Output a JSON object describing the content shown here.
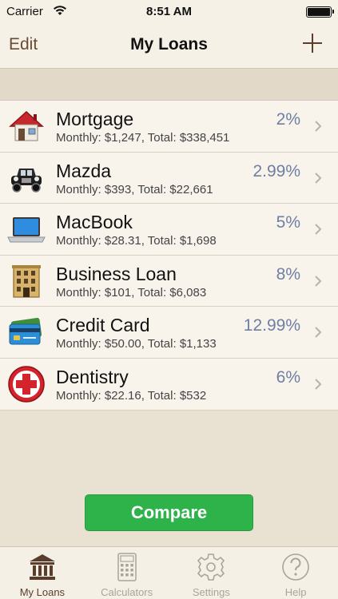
{
  "status_bar": {
    "carrier": "Carrier",
    "time": "8:51 AM"
  },
  "nav": {
    "edit_label": "Edit",
    "title": "My Loans"
  },
  "loans": [
    {
      "name": "Mortgage",
      "summary": "Monthly: $1,247, Total: $338,451",
      "rate": "2%",
      "icon": "house-icon"
    },
    {
      "name": "Mazda",
      "summary": "Monthly: $393, Total: $22,661",
      "rate": "2.99%",
      "icon": "car-icon"
    },
    {
      "name": "MacBook",
      "summary": "Monthly: $28.31, Total: $1,698",
      "rate": "5%",
      "icon": "laptop-icon"
    },
    {
      "name": "Business Loan",
      "summary": "Monthly: $101, Total: $6,083",
      "rate": "8%",
      "icon": "building-icon"
    },
    {
      "name": "Credit Card",
      "summary": "Monthly: $50.00, Total: $1,133",
      "rate": "12.99%",
      "icon": "credit-card-icon"
    },
    {
      "name": "Dentistry",
      "summary": "Monthly: $22.16, Total: $532",
      "rate": "6%",
      "icon": "red-cross-icon"
    }
  ],
  "compare_label": "Compare",
  "tabs": [
    {
      "label": "My Loans",
      "icon": "bank-icon",
      "active": true
    },
    {
      "label": "Calculators",
      "icon": "calculator-icon",
      "active": false
    },
    {
      "label": "Settings",
      "icon": "gear-icon",
      "active": false
    },
    {
      "label": "Help",
      "icon": "help-icon",
      "active": false
    }
  ],
  "colors": {
    "accent": "#6b4b33",
    "rate": "#6e7fa3",
    "compare": "#2eb34a",
    "background": "#e9e1d2"
  }
}
